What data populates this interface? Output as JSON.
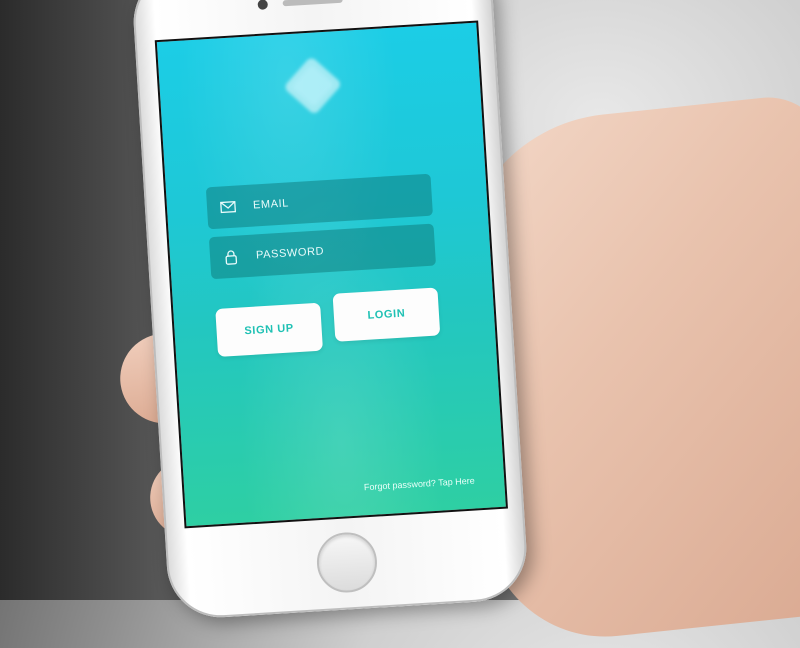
{
  "screen": {
    "email": {
      "label": "EMAIL",
      "icon": "envelope-icon"
    },
    "password": {
      "label": "PASSWORD",
      "icon": "lock-icon"
    },
    "signup_button": "SIGN UP",
    "login_button": "LOGIN",
    "forgot_link": "Forgot password? Tap Here",
    "logo_icon": "app-logo-icon",
    "colors": {
      "gradient_top": "#1ccde6",
      "gradient_bottom": "#2ecfa3",
      "button_text": "#1fc1b4"
    }
  }
}
